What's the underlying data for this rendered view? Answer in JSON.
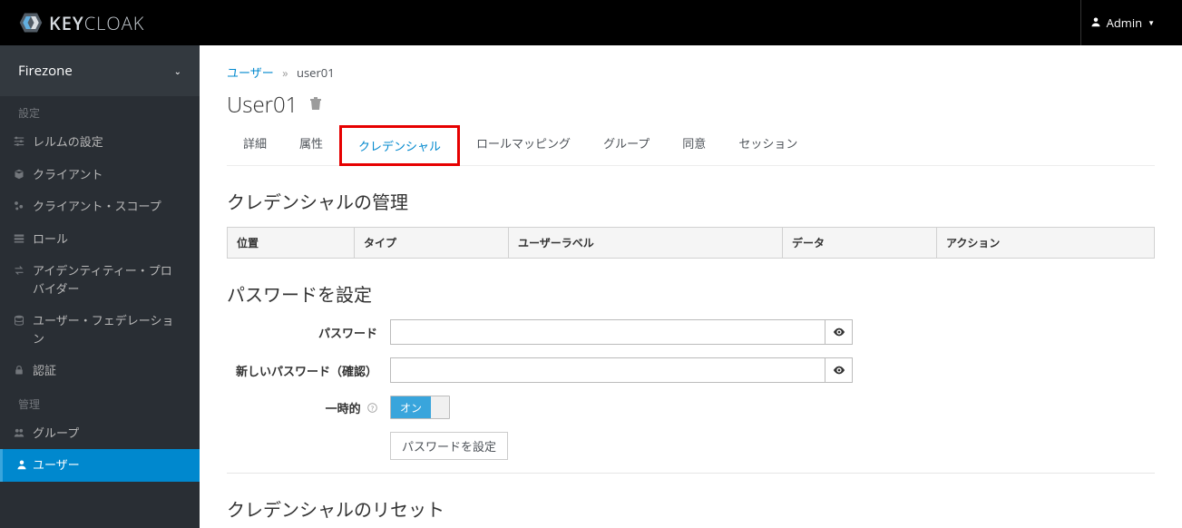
{
  "header": {
    "brand_bold": "KEY",
    "brand_rest": "CLOAK",
    "user_label": "Admin"
  },
  "sidebar": {
    "realm": "Firezone",
    "section_config": "設定",
    "section_manage": "管理",
    "items_config": [
      {
        "label": "レルムの設定",
        "icon": "sliders"
      },
      {
        "label": "クライアント",
        "icon": "cube"
      },
      {
        "label": "クライアント・スコープ",
        "icon": "scopes"
      },
      {
        "label": "ロール",
        "icon": "list"
      },
      {
        "label": "アイデンティティー・プロバイダー",
        "icon": "exchange"
      },
      {
        "label": "ユーザー・フェデレーション",
        "icon": "database"
      },
      {
        "label": "認証",
        "icon": "lock"
      }
    ],
    "items_manage": [
      {
        "label": "グループ",
        "icon": "group"
      },
      {
        "label": "ユーザー",
        "icon": "user",
        "active": true
      }
    ]
  },
  "breadcrumb": {
    "root": "ユーザー",
    "current": "user01"
  },
  "page": {
    "title": "User01",
    "tabs": [
      {
        "label": "詳細"
      },
      {
        "label": "属性"
      },
      {
        "label": "クレデンシャル",
        "active": true,
        "highlighted": true
      },
      {
        "label": "ロールマッピング"
      },
      {
        "label": "グループ"
      },
      {
        "label": "同意"
      },
      {
        "label": "セッション"
      }
    ]
  },
  "credentials": {
    "manage_title": "クレデンシャルの管理",
    "table_headers": [
      "位置",
      "タイプ",
      "ユーザーラベル",
      "データ",
      "アクション"
    ],
    "form_title": "パスワードを設定",
    "password_label": "パスワード",
    "confirm_label": "新しいパスワード（確認）",
    "temporary_label": "一時的",
    "toggle_on": "オン",
    "submit_label": "パスワードを設定",
    "reset_title": "クレデンシャルのリセット"
  }
}
